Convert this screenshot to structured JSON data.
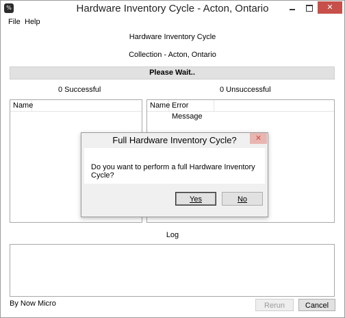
{
  "window": {
    "title": "Hardware Inventory Cycle - Acton, Ontario",
    "icon_glyph": "%",
    "close_glyph": "✕"
  },
  "menu": {
    "file": "File",
    "help": "Help"
  },
  "main": {
    "heading": "Hardware Inventory Cycle",
    "collection": "Collection - Acton, Ontario",
    "status": "Please Wait..",
    "successful_label": "0 Successful",
    "unsuccessful_label": "0 Unsuccessful",
    "left_list": {
      "columns": [
        "Name"
      ]
    },
    "right_list": {
      "columns": [
        "Name",
        "Error Message"
      ]
    },
    "log_label": "Log"
  },
  "footer": {
    "credit": "By Now Micro",
    "rerun_label": "Rerun",
    "cancel_label": "Cancel"
  },
  "dialog": {
    "title": "Full Hardware Inventory Cycle?",
    "message": "Do you want to perform a full Hardware Inventory Cycle?",
    "yes_label": "Yes",
    "no_label": "No",
    "close_glyph": "✕"
  },
  "colors": {
    "close_button": "#c7504a",
    "dialog_close": "#e9b5b1",
    "wait_bar": "#e1e1e1",
    "disabled_text": "#9a9a9a"
  }
}
